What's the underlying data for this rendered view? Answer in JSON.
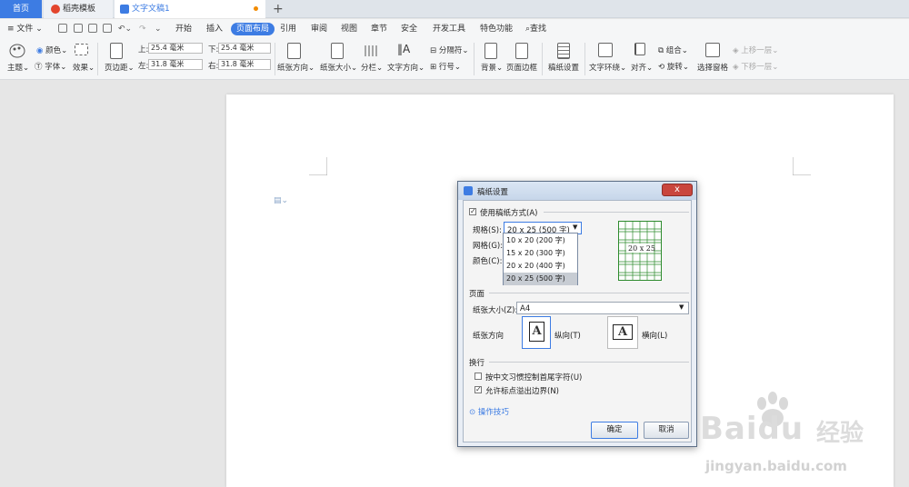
{
  "tabs": {
    "home": "首页",
    "template": "稻壳模板",
    "document": "文字文稿1",
    "add": "+"
  },
  "menu": {
    "file": "文件",
    "items": [
      "开始",
      "插入",
      "页面布局",
      "引用",
      "审阅",
      "视图",
      "章节",
      "安全",
      "开发工具",
      "特色功能"
    ],
    "active_index": 2,
    "search": "查找"
  },
  "ribbon": {
    "theme": "主题",
    "color": "颜色",
    "font": "字体",
    "effect": "效果",
    "margins": "页边距",
    "top_label": "上:",
    "top_value": "25.4 毫米",
    "bottom_label": "下:",
    "bottom_value": "25.4 毫米",
    "left_label": "左:",
    "left_value": "31.8 毫米",
    "right_label": "右:",
    "right_value": "31.8 毫米",
    "orientation": "纸张方向",
    "size": "纸张大小",
    "columns": "分栏",
    "text_direction": "文字方向",
    "separator": "分隔符",
    "line_number": "行号",
    "background": "背景",
    "page_border": "页面边框",
    "manuscript": "稿纸设置",
    "text_wrap": "文字环绕",
    "align": "对齐",
    "group": "组合",
    "rotate": "旋转",
    "selection_pane": "选择窗格",
    "bring_forward": "上移一层",
    "send_backward": "下移一层"
  },
  "dialog": {
    "title": "稿纸设置",
    "use_manuscript": "使用稿纸方式(A)",
    "spec_label": "规格(S):",
    "spec_value": "20 x 25 (500 字)",
    "grid_label": "网格(G):",
    "color_label": "颜色(C):",
    "preview_text": "20 x 25",
    "page_section": "页面",
    "paper_size_label": "纸张大小(Z):",
    "paper_size_value": "A4",
    "orientation_label": "纸张方向",
    "portrait": "纵向(T)",
    "landscape": "横向(L)",
    "orientation_icon_letter": "A",
    "wrap_section": "换行",
    "chinese_rule": "按中文习惯控制首尾字符(U)",
    "allow_punct": "允许标点溢出边界(N)",
    "tips": "操作技巧",
    "ok": "确定",
    "cancel": "取消",
    "close": "x"
  },
  "spec_options": [
    "10 x 20 (200 字)",
    "15 x 20 (300 字)",
    "20 x 20 (400 字)",
    "20 x 25 (500 字)"
  ],
  "selected_option_index": 3,
  "watermark": {
    "brand": "Baidu",
    "brand_cn": "经验",
    "url": "jingyan.baidu.com"
  },
  "colors": {
    "accent": "#3d7ce3",
    "grid_green": "#2e8b2e",
    "close_red": "#c9463d",
    "selected_option": "#c7ccd3"
  }
}
